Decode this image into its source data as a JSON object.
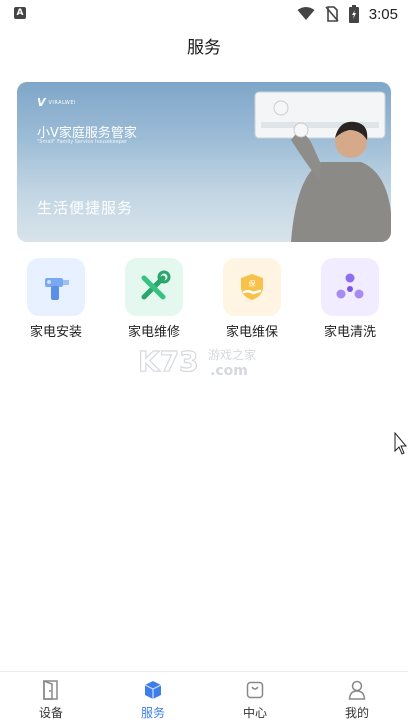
{
  "status_bar": {
    "time": "3:05",
    "left_badge": "A",
    "icons": [
      "wifi-icon",
      "no-sim-icon",
      "battery-charging-icon"
    ]
  },
  "header": {
    "title": "服务"
  },
  "banner": {
    "logo_text": "V",
    "logo_brand": "VIRALWEI",
    "heading": "小V家庭服务管家",
    "subheading": "\"Small\" Family Service housekeeper",
    "slogan": "生活便捷服务"
  },
  "services": [
    {
      "label": "家电安装",
      "icon": "drill-icon",
      "color": "#e8f1ff"
    },
    {
      "label": "家电维修",
      "icon": "tools-icon",
      "color": "#e4f8ef"
    },
    {
      "label": "家电维保",
      "icon": "shield-hand-icon",
      "color": "#fff5e2"
    },
    {
      "label": "家电清洗",
      "icon": "fan-icon",
      "color": "#f1ecff"
    }
  ],
  "watermark": {
    "text_main": "K73",
    "text_cn": "游戏之家",
    "text_domain": ".com"
  },
  "bottom_nav": [
    {
      "label": "设备",
      "icon": "door-icon",
      "active": false
    },
    {
      "label": "服务",
      "icon": "cube-icon",
      "active": true
    },
    {
      "label": "中心",
      "icon": "bag-icon",
      "active": false
    },
    {
      "label": "我的",
      "icon": "user-icon",
      "active": false
    }
  ],
  "colors": {
    "accent": "#3d7eea",
    "text": "#1f1f1f"
  }
}
